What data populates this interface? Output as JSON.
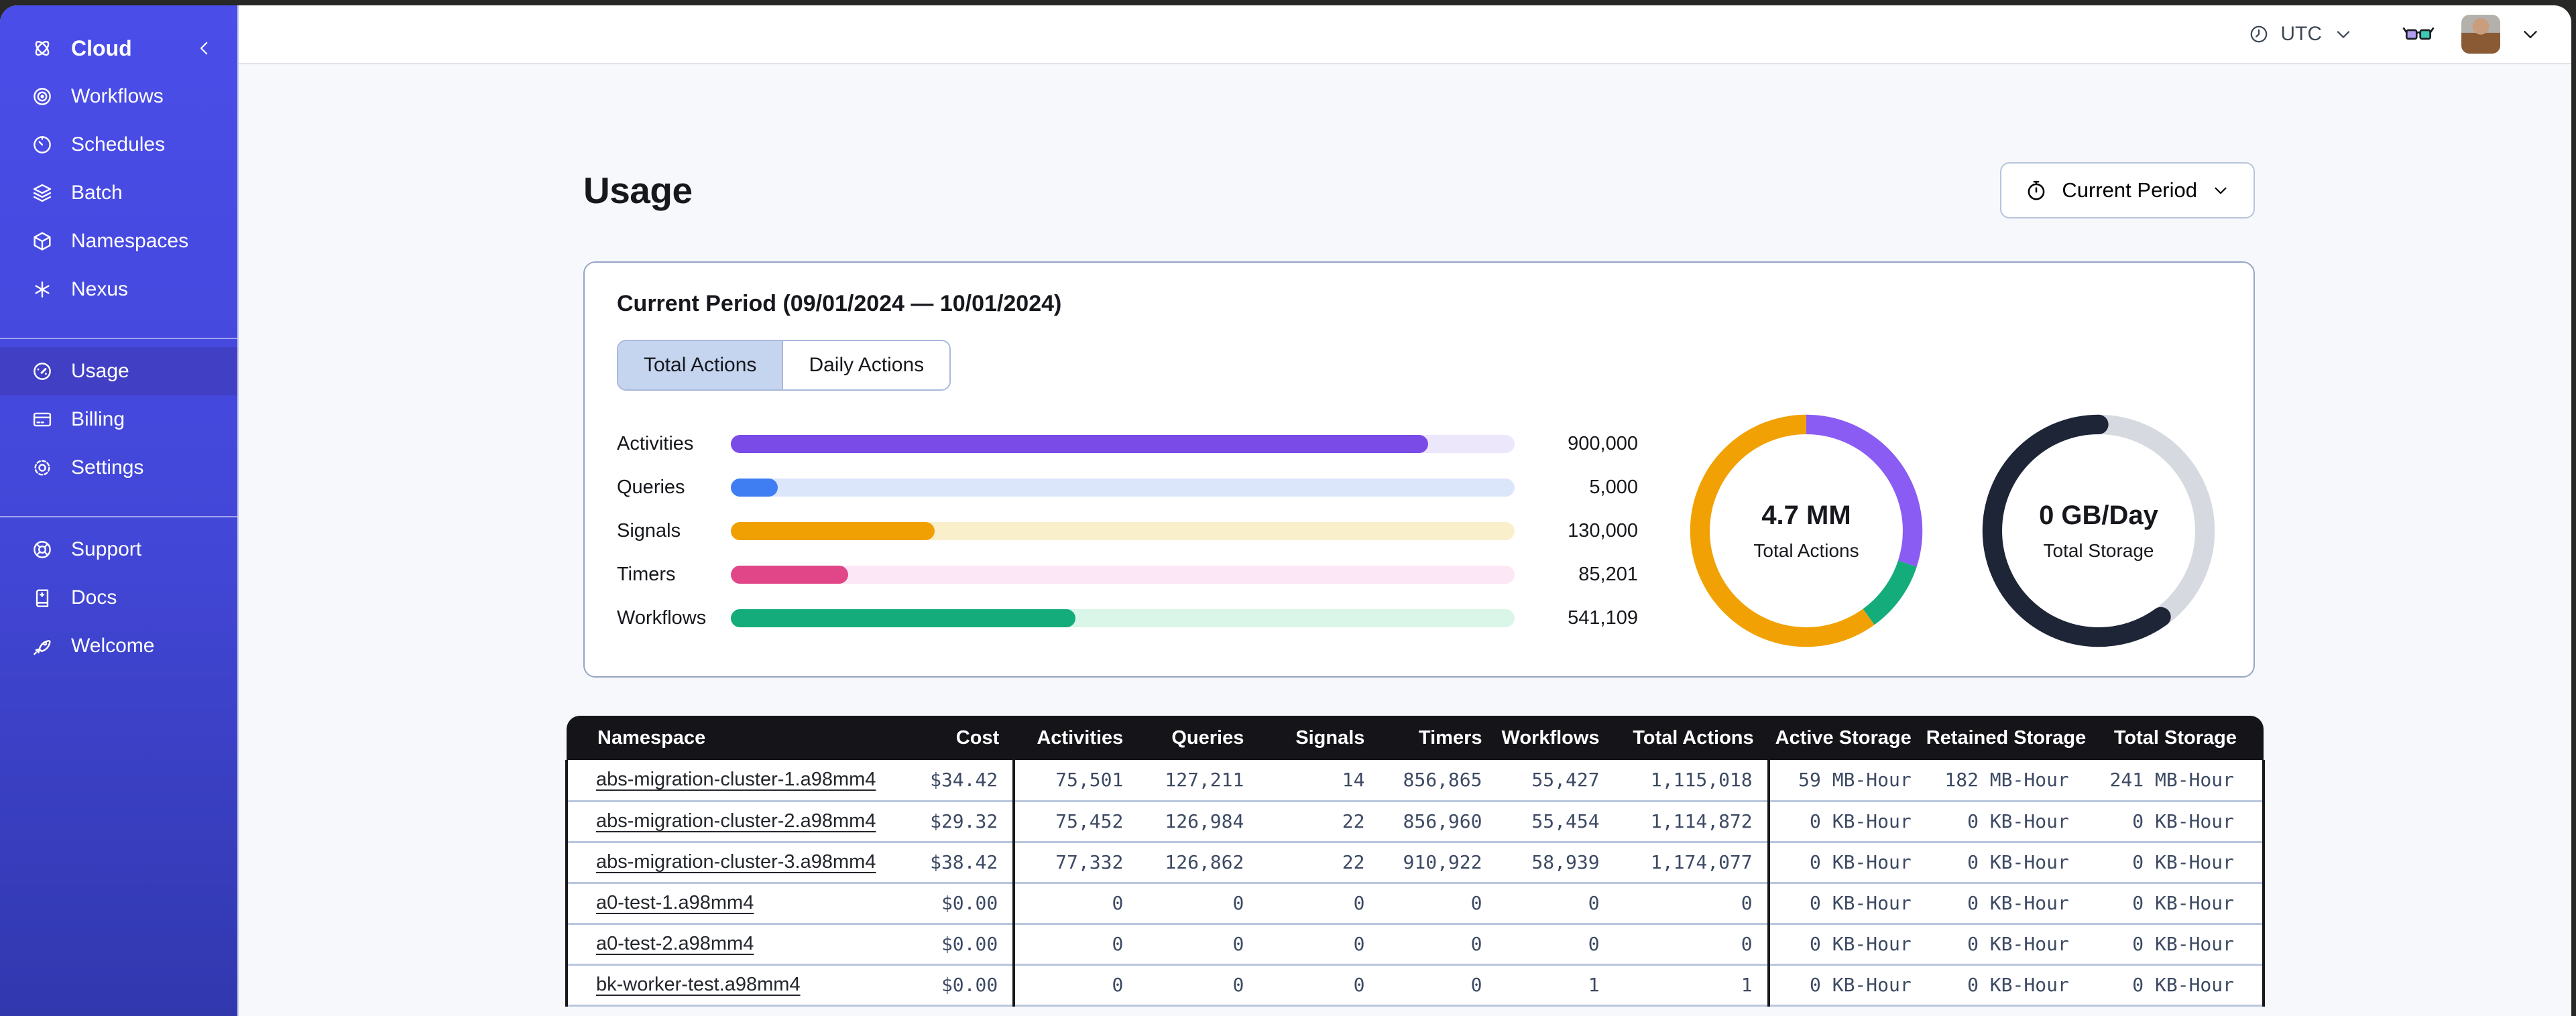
{
  "topbar": {
    "timezone": {
      "icon": "clock-icon",
      "label": "UTC"
    },
    "feedback_icon": "glasses-icon",
    "avatar": "user-avatar"
  },
  "sidebar": {
    "sections": [
      {
        "items": [
          {
            "icon": "temporal-logo-icon",
            "label": "Cloud",
            "collapse_icon": "chevron-left-icon",
            "active": false
          },
          {
            "icon": "workflows-icon",
            "label": "Workflows",
            "active": false
          },
          {
            "icon": "schedules-icon",
            "label": "Schedules",
            "active": false
          },
          {
            "icon": "batch-icon",
            "label": "Batch",
            "active": false
          },
          {
            "icon": "namespaces-icon",
            "label": "Namespaces",
            "active": false
          },
          {
            "icon": "nexus-icon",
            "label": "Nexus",
            "active": false
          }
        ]
      },
      {
        "items": [
          {
            "icon": "usage-icon",
            "label": "Usage",
            "active": true
          },
          {
            "icon": "billing-icon",
            "label": "Billing",
            "active": false
          },
          {
            "icon": "settings-icon",
            "label": "Settings",
            "active": false
          }
        ]
      },
      {
        "items": [
          {
            "icon": "support-icon",
            "label": "Support",
            "active": false
          },
          {
            "icon": "docs-icon",
            "label": "Docs",
            "active": false
          },
          {
            "icon": "welcome-icon",
            "label": "Welcome",
            "active": false
          }
        ]
      }
    ]
  },
  "page": {
    "title": "Usage",
    "period_button": {
      "icon": "stopwatch-icon",
      "label": "Current Period"
    }
  },
  "card": {
    "title": "Current Period (09/01/2024 — 10/01/2024)",
    "tabs": [
      {
        "label": "Total Actions",
        "selected": true
      },
      {
        "label": "Daily Actions",
        "selected": false
      }
    ]
  },
  "chart_data": [
    {
      "type": "bar",
      "orientation": "horizontal",
      "categories": [
        "Activities",
        "Queries",
        "Signals",
        "Timers",
        "Workflows"
      ],
      "values": [
        900000,
        5000,
        130000,
        85201,
        541109
      ],
      "value_labels": [
        "900,000",
        "5,000",
        "130,000",
        "85,201",
        "541,109"
      ],
      "fill_fractions": [
        0.89,
        0.06,
        0.26,
        0.15,
        0.44
      ],
      "colors": [
        "#7b4be8",
        "#3f7ef2",
        "#f1a004",
        "#e14788",
        "#14ac7b"
      ],
      "track_colors": [
        "#ece7fb",
        "#dbe6fb",
        "#faefcb",
        "#fbe7f5",
        "#d9f6e9"
      ]
    },
    {
      "type": "pie",
      "title": "4.7 MM",
      "subtitle": "Total Actions",
      "segments": [
        {
          "label": "Activities",
          "fraction": 0.3,
          "color": "#8a5cf3"
        },
        {
          "label": "Workflows",
          "fraction": 0.1,
          "color": "#14ac7b"
        },
        {
          "label": "Signals",
          "fraction": 0.6,
          "color": "#f2a104"
        }
      ]
    },
    {
      "type": "pie",
      "title": "0 GB/Day",
      "subtitle": "Total Storage",
      "segments": [
        {
          "label": "remaining",
          "fraction": 0.4,
          "color": "#d6d9df"
        },
        {
          "label": "used",
          "fraction": 0.6,
          "color": "#1d2537"
        }
      ]
    }
  ],
  "table": {
    "columns": [
      "Namespace",
      "Cost",
      "Activities",
      "Queries",
      "Signals",
      "Timers",
      "Workflows",
      "Total Actions",
      "Active Storage",
      "Retained Storage",
      "Total Storage"
    ],
    "rows": [
      [
        "abs-migration-cluster-1.a98mm4",
        "$34.42",
        "75,501",
        "127,211",
        "14",
        "856,865",
        "55,427",
        "1,115,018",
        "59 MB-Hour",
        "182 MB-Hour",
        "241 MB-Hour"
      ],
      [
        "abs-migration-cluster-2.a98mm4",
        "$29.32",
        "75,452",
        "126,984",
        "22",
        "856,960",
        "55,454",
        "1,114,872",
        "0 KB-Hour",
        "0 KB-Hour",
        "0 KB-Hour"
      ],
      [
        "abs-migration-cluster-3.a98mm4",
        "$38.42",
        "77,332",
        "126,862",
        "22",
        "910,922",
        "58,939",
        "1,174,077",
        "0 KB-Hour",
        "0 KB-Hour",
        "0 KB-Hour"
      ],
      [
        "a0-test-1.a98mm4",
        "$0.00",
        "0",
        "0",
        "0",
        "0",
        "0",
        "0",
        "0 KB-Hour",
        "0 KB-Hour",
        "0 KB-Hour"
      ],
      [
        "a0-test-2.a98mm4",
        "$0.00",
        "0",
        "0",
        "0",
        "0",
        "0",
        "0",
        "0 KB-Hour",
        "0 KB-Hour",
        "0 KB-Hour"
      ],
      [
        "bk-worker-test.a98mm4",
        "$0.00",
        "0",
        "0",
        "0",
        "0",
        "1",
        "1",
        "0 KB-Hour",
        "0 KB-Hour",
        "0 KB-Hour"
      ]
    ]
  },
  "colors": {
    "sidebar_top": "#4a4de8",
    "sidebar_bottom": "#3138ae",
    "sidebar_active": "#413fc4",
    "content_bg": "#f7f8fb",
    "card_border": "#96a5c5",
    "tab_selected_bg": "#c5d4ef",
    "table_header_bg": "#141419",
    "table_text": "#3d4a63",
    "row_divider": "#b9c6dd"
  }
}
